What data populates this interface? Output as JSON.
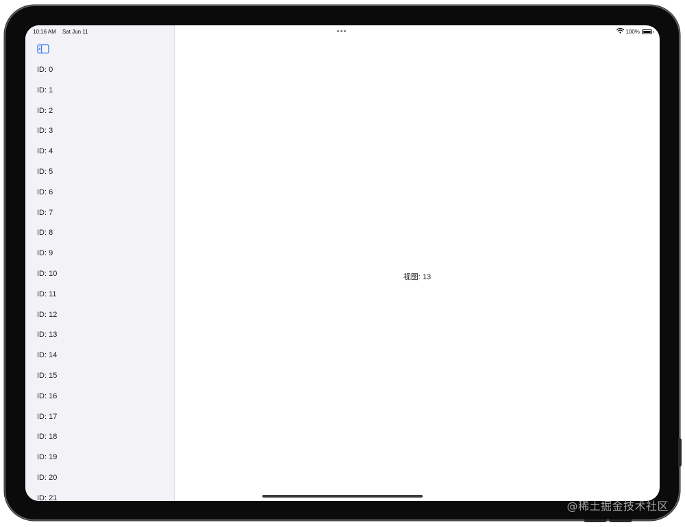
{
  "status_bar": {
    "time": "10:16 AM",
    "date": "Sat Jun 11",
    "battery": "100%",
    "battery_level": 1.0
  },
  "sidebar": {
    "toggle_icon": "sidebar-toggle-icon",
    "items": [
      {
        "label": "ID: 0"
      },
      {
        "label": "ID: 1"
      },
      {
        "label": "ID: 2"
      },
      {
        "label": "ID: 3"
      },
      {
        "label": "ID: 4"
      },
      {
        "label": "ID: 5"
      },
      {
        "label": "ID: 6"
      },
      {
        "label": "ID: 7"
      },
      {
        "label": "ID: 8"
      },
      {
        "label": "ID: 9"
      },
      {
        "label": "ID: 10"
      },
      {
        "label": "ID: 11"
      },
      {
        "label": "ID: 12"
      },
      {
        "label": "ID: 13"
      },
      {
        "label": "ID: 14"
      },
      {
        "label": "ID: 15"
      },
      {
        "label": "ID: 16"
      },
      {
        "label": "ID: 17"
      },
      {
        "label": "ID: 18"
      },
      {
        "label": "ID: 19"
      },
      {
        "label": "ID: 20"
      },
      {
        "label": "ID: 21"
      }
    ]
  },
  "detail": {
    "label": "视图: 13"
  },
  "watermark": "@稀土掘金技术社区",
  "colors": {
    "accent": "#3478f6",
    "sidebar_background": "#f2f2f7",
    "device_frame": "#0b0b0c"
  }
}
